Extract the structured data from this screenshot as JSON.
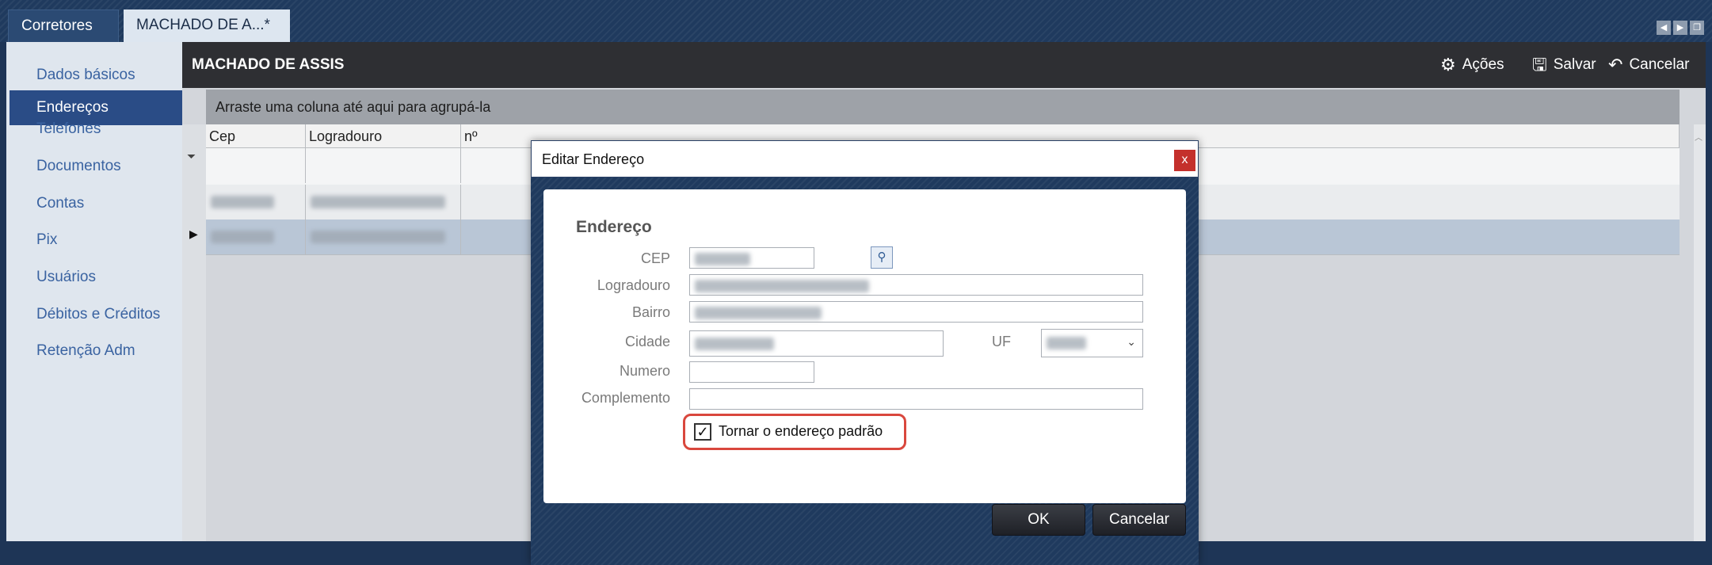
{
  "tabs": [
    {
      "label": "Corretores"
    },
    {
      "label": "MACHADO DE A...*"
    }
  ],
  "nav_icons": [
    "chevron-left-icon",
    "chevron-right-icon",
    "restore-icon"
  ],
  "sidebar": {
    "items": [
      {
        "label": "Dados básicos",
        "active": false
      },
      {
        "label": "Endereços",
        "active": true
      },
      {
        "label": "Telefones",
        "active": false
      },
      {
        "label": "Documentos",
        "active": false
      },
      {
        "label": "Contas",
        "active": false
      },
      {
        "label": "Pix",
        "active": false
      },
      {
        "label": "Usuários",
        "active": false
      },
      {
        "label": "Débitos e Créditos",
        "active": false
      },
      {
        "label": "Retenção Adm",
        "active": false
      }
    ]
  },
  "header": {
    "title": "MACHADO DE ASSIS",
    "actions": {
      "acoes": {
        "label": "Ações",
        "icon": "gear-icon"
      },
      "salvar": {
        "label": "Salvar",
        "icon": "save-icon"
      },
      "cancelar": {
        "label": "Cancelar",
        "icon": "undo-icon"
      }
    }
  },
  "grid": {
    "group_hint": "Arraste uma coluna até aqui para agrupá-la",
    "columns": [
      "Cep",
      "Logradouro",
      "nº"
    ],
    "rows": [
      {
        "selected": false
      },
      {
        "selected": true
      }
    ]
  },
  "dialog": {
    "title": "Editar Endereço",
    "close_label": "x",
    "section_title": "Endereço",
    "labels": {
      "cep": "CEP",
      "logradouro": "Logradouro",
      "bairro": "Bairro",
      "cidade": "Cidade",
      "uf": "UF",
      "numero": "Numero",
      "complemento": "Complemento"
    },
    "numero_value": "",
    "complemento_value": "",
    "default_checkbox": {
      "label": "Tornar o endereço padrão",
      "checked": true
    },
    "ok_label": "OK",
    "cancel_label": "Cancelar"
  },
  "colors": {
    "accent_blue": "#2a4c86",
    "close_red": "#c4302c",
    "highlight_red": "#d9473d"
  }
}
